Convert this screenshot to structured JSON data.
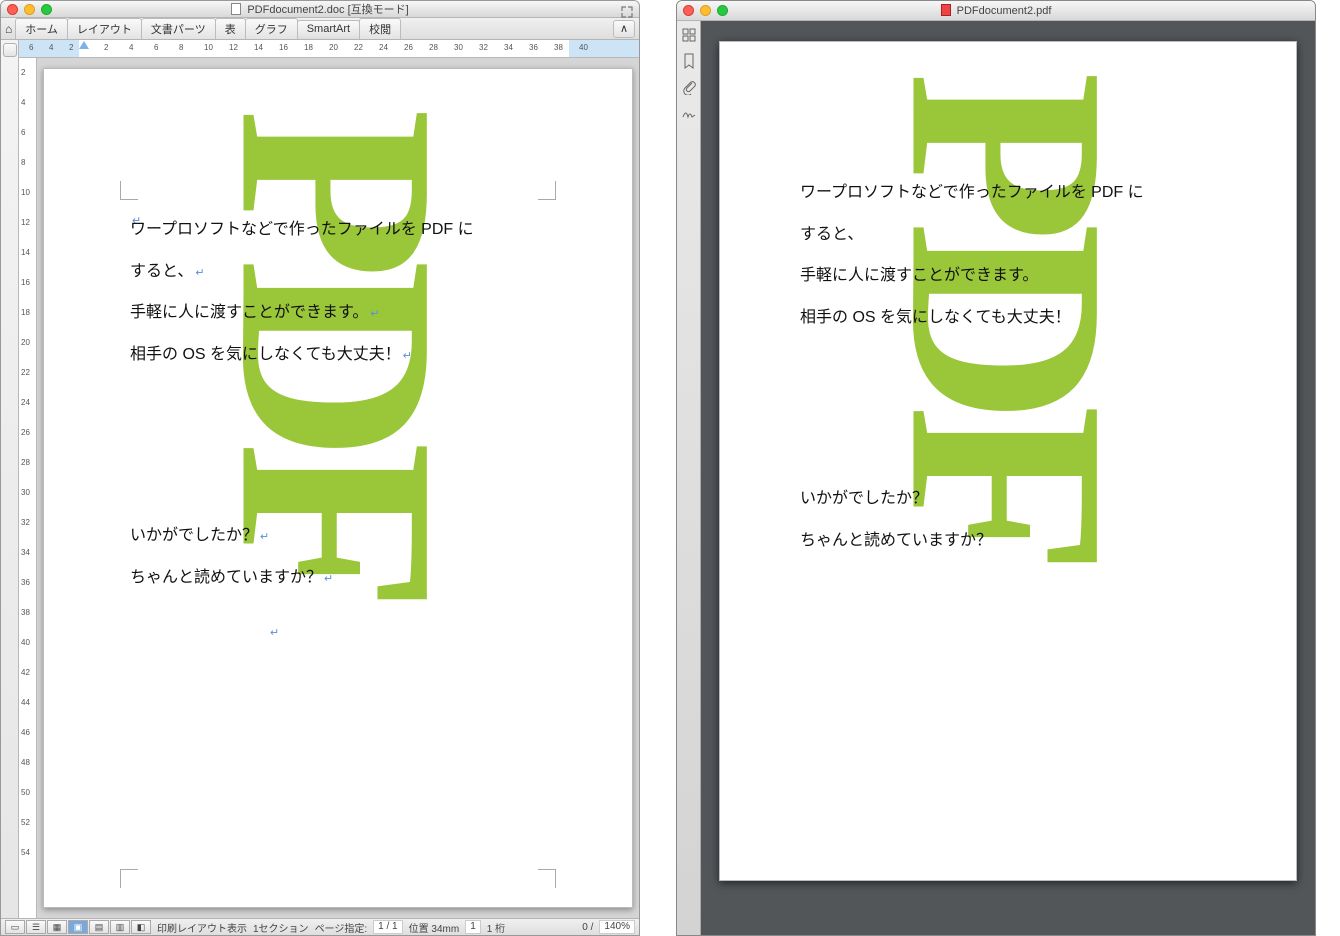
{
  "word": {
    "title": "PDFdocument2.doc [互換モード]",
    "tabs": [
      "ホーム",
      "レイアウト",
      "文書パーツ",
      "表",
      "グラフ",
      "SmartArt",
      "校閲"
    ],
    "ruler_numbers": [
      "6",
      "4",
      "2",
      "2",
      "4",
      "6",
      "8",
      "10",
      "12",
      "14",
      "16",
      "18",
      "20",
      "22",
      "24",
      "26",
      "28",
      "30",
      "32",
      "34",
      "36",
      "38",
      "40"
    ],
    "v_ruler_numbers": [
      "2",
      "4",
      "6",
      "8",
      "10",
      "12",
      "14",
      "16",
      "18",
      "20",
      "22",
      "24",
      "26",
      "28",
      "30",
      "32",
      "34",
      "36",
      "38",
      "40",
      "42",
      "44",
      "46",
      "48",
      "50",
      "52",
      "54"
    ],
    "status": {
      "view_label": "印刷レイアウト表示",
      "section": "1セクション",
      "page_label": "ページ指定:",
      "page_val": "1 / 1",
      "pos_label": "位置 34mm",
      "line": "1",
      "col_label": "1 桁",
      "words": "0 /",
      "zoom": "140%"
    }
  },
  "pdf": {
    "title": "PDFdocument2.pdf"
  },
  "doc": {
    "bg_text": "PDF",
    "lines": [
      "ワープロソフトなどで作ったファイルを PDF に",
      "すると、",
      "手軽に人に渡すことができます。",
      "相手の OS を気にしなくても大丈夫！"
    ],
    "serif_lines": [
      "いかがでしたか？",
      "ちゃんと読めていますか？"
    ]
  },
  "colors": {
    "pdf_green": "#9ac63a"
  }
}
